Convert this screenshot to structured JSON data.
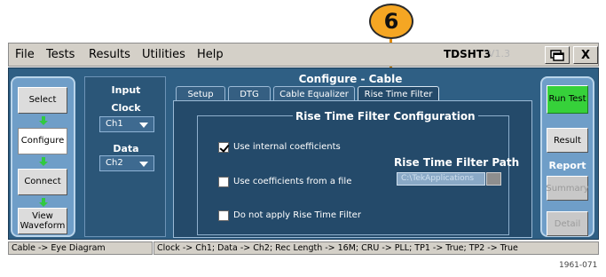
{
  "callout": {
    "number": "6"
  },
  "menu": [
    "File",
    "Tests",
    "Results",
    "Utilities",
    "Help"
  ],
  "app": {
    "name": "TDSHT3",
    "version": "V1.3"
  },
  "window_buttons": {
    "minimize_icon": "minimize-window-icon",
    "close_label": "X"
  },
  "left_nav": {
    "items": [
      "Select",
      "Configure",
      "Connect",
      "View Waveform"
    ],
    "active": "Configure"
  },
  "input_panel": {
    "title": "Input",
    "clock_label": "Clock",
    "clock_value": "Ch1",
    "data_label": "Data",
    "data_value": "Ch2"
  },
  "config": {
    "title": "Configure - Cable",
    "tabs": [
      "Setup",
      "DTG",
      "Cable Equalizer",
      "Rise Time Filter"
    ],
    "active_tab": "Rise Time Filter",
    "group_title": "Rise Time Filter Configuration",
    "options": [
      {
        "label": "Use internal coefficients",
        "checked": true
      },
      {
        "label": "Use coefficients from a file",
        "checked": false
      },
      {
        "label": "Do not apply Rise Time Filter",
        "checked": false
      }
    ],
    "path_title": "Rise Time Filter Path",
    "path_value": "C:\\TekApplications"
  },
  "right_panel": {
    "run_test": "Run Test",
    "result": "Result",
    "report_title": "Report",
    "summary": "Summary",
    "detail": "Detail"
  },
  "status": {
    "left": "Cable -> Eye Diagram",
    "right": "Clock -> Ch1; Data -> Ch2; Rec Length -> 16M; CRU -> PLL; TP1 -> True; TP2 -> True"
  },
  "figure_id": "1961-071",
  "colors": {
    "frame": "#2f5f84",
    "nav": "#6f9ec8",
    "run": "#36d13a",
    "callout": "#f5a623"
  }
}
